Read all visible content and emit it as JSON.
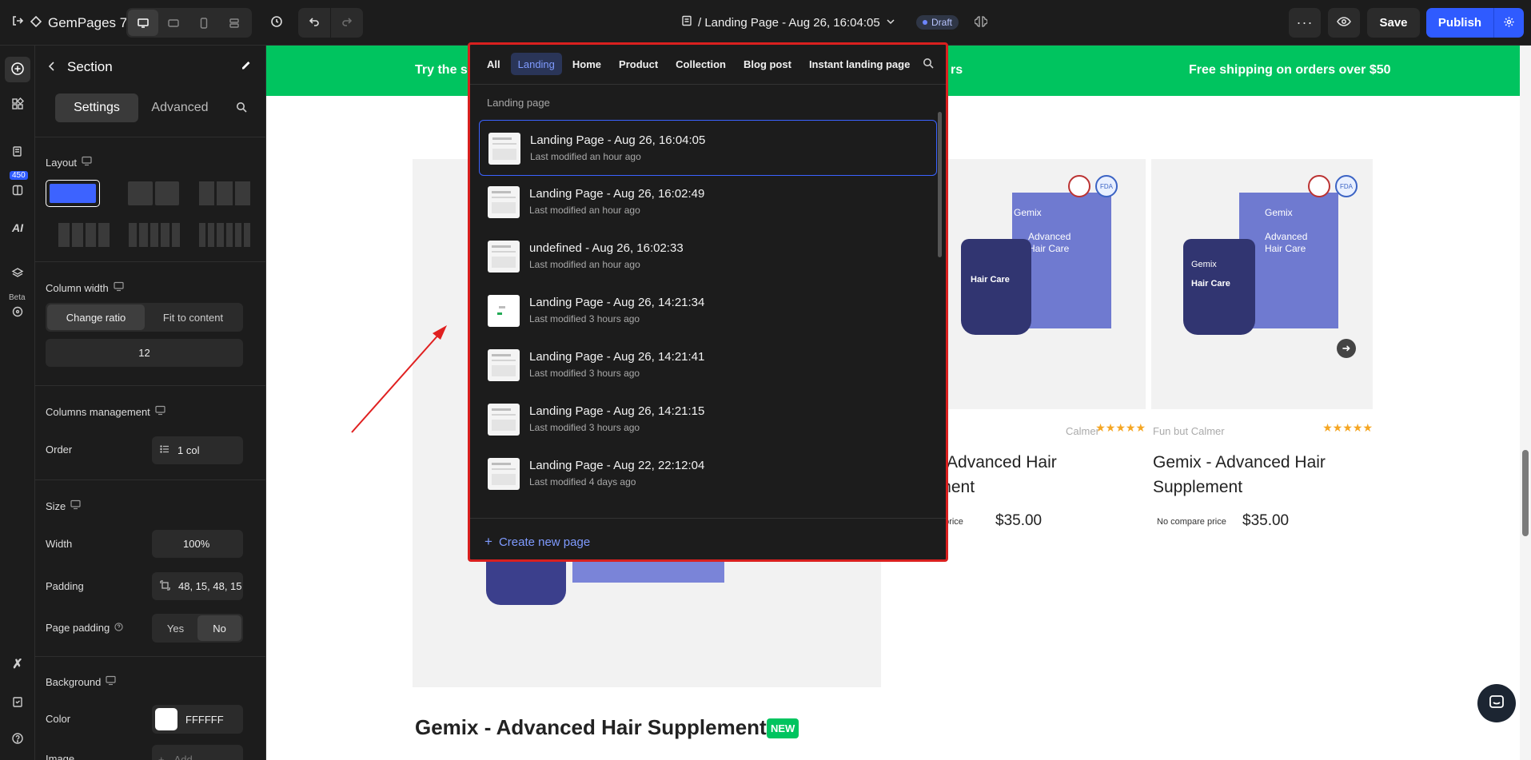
{
  "app": {
    "name": "GemPages 7",
    "page_title": "/ Landing Page - Aug 26, 16:04:05",
    "status": "Draft"
  },
  "toolbar": {
    "save_label": "Save",
    "publish_label": "Publish"
  },
  "rail": {
    "badge": "450",
    "beta": "Beta",
    "ai": "AI"
  },
  "panel": {
    "title": "Section",
    "tabs": [
      "Settings",
      "Advanced"
    ],
    "layout_label": "Layout",
    "column_width_label": "Column width",
    "column_width_options": [
      "Change ratio",
      "Fit to content"
    ],
    "ratio_value": "12",
    "columns_management_label": "Columns management",
    "order_label": "Order",
    "order_value": "1 col",
    "size_label": "Size",
    "width_label": "Width",
    "width_value": "100%",
    "padding_label": "Padding",
    "padding_value": "48, 15, 48, 15",
    "page_padding_label": "Page padding",
    "page_padding_options": [
      "Yes",
      "No"
    ],
    "background_label": "Background",
    "color_label": "Color",
    "color_value": "FFFFFF",
    "image_label": "Image",
    "image_placeholder": "Add"
  },
  "canvas": {
    "banner_left": "Try the sc",
    "banner_mid": "rs",
    "banner_right": "Free shipping on orders over $50",
    "main_title": "Gemix - Advanced Hair Supplement",
    "new_badge": "NEW",
    "products": [
      {
        "vendor": "Calmer",
        "name_line1": "x - Advanced Hair",
        "name_line2": "lement",
        "compare": "pare price",
        "price": "$35.00"
      },
      {
        "vendor": "Fun but Calmer",
        "name_line1": "Gemix - Advanced Hair",
        "name_line2": "Supplement",
        "compare": "No compare price",
        "price": "$35.00"
      }
    ],
    "stars": "★★★★★",
    "box_brand": "Gemix",
    "box_text1": "Advanced",
    "box_text2": "Hair Care",
    "badge_text": "FDA"
  },
  "dropdown": {
    "tabs": [
      "All",
      "Landing",
      "Home",
      "Product",
      "Collection",
      "Blog post",
      "Instant landing page"
    ],
    "section_label": "Landing page",
    "items": [
      {
        "name": "Landing Page - Aug 26, 16:04:05",
        "meta": "Last modified an hour ago"
      },
      {
        "name": "Landing Page - Aug 26, 16:02:49",
        "meta": "Last modified an hour ago"
      },
      {
        "name": "undefined - Aug 26, 16:02:33",
        "meta": "Last modified an hour ago"
      },
      {
        "name": "Landing Page - Aug 26, 14:21:34",
        "meta": "Last modified 3 hours ago"
      },
      {
        "name": "Landing Page - Aug 26, 14:21:41",
        "meta": "Last modified 3 hours ago"
      },
      {
        "name": "Landing Page - Aug 26, 14:21:15",
        "meta": "Last modified 3 hours ago"
      },
      {
        "name": "Landing Page - Aug 22, 22:12:04",
        "meta": "Last modified 4 days ago"
      }
    ],
    "create_label": "Create new page"
  },
  "colors": {
    "accent": "#2f5bff",
    "banner": "#00c45f",
    "highlight": "#d9201f",
    "star": "#f5a623"
  }
}
